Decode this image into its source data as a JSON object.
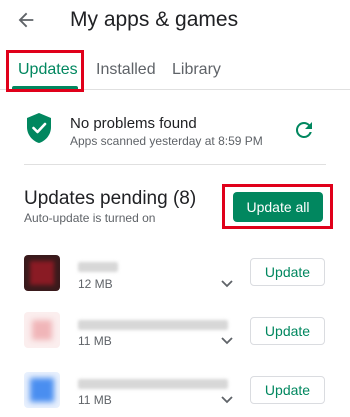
{
  "header": {
    "title": "My apps & games",
    "back_icon": "arrow-back-icon"
  },
  "tabs": [
    {
      "label": "Updates",
      "active": true
    },
    {
      "label": "Installed",
      "active": false
    },
    {
      "label": "Library",
      "active": false
    }
  ],
  "status": {
    "title": "No problems found",
    "subtitle": "Apps scanned yesterday at 8:59 PM",
    "icon": "shield-check-icon",
    "refresh_icon": "refresh-icon"
  },
  "pending": {
    "title": "Updates pending (8)",
    "subtitle": "Auto-update is turned on",
    "update_all_label": "Update all"
  },
  "apps": [
    {
      "size": "12 MB",
      "update_label": "Update"
    },
    {
      "size": "11 MB",
      "update_label": "Update"
    },
    {
      "size": "11 MB",
      "update_label": "Update"
    }
  ],
  "colors": {
    "accent": "#01875f",
    "highlight": "#e0001a",
    "text_primary": "#202124",
    "text_secondary": "#5f6368"
  }
}
